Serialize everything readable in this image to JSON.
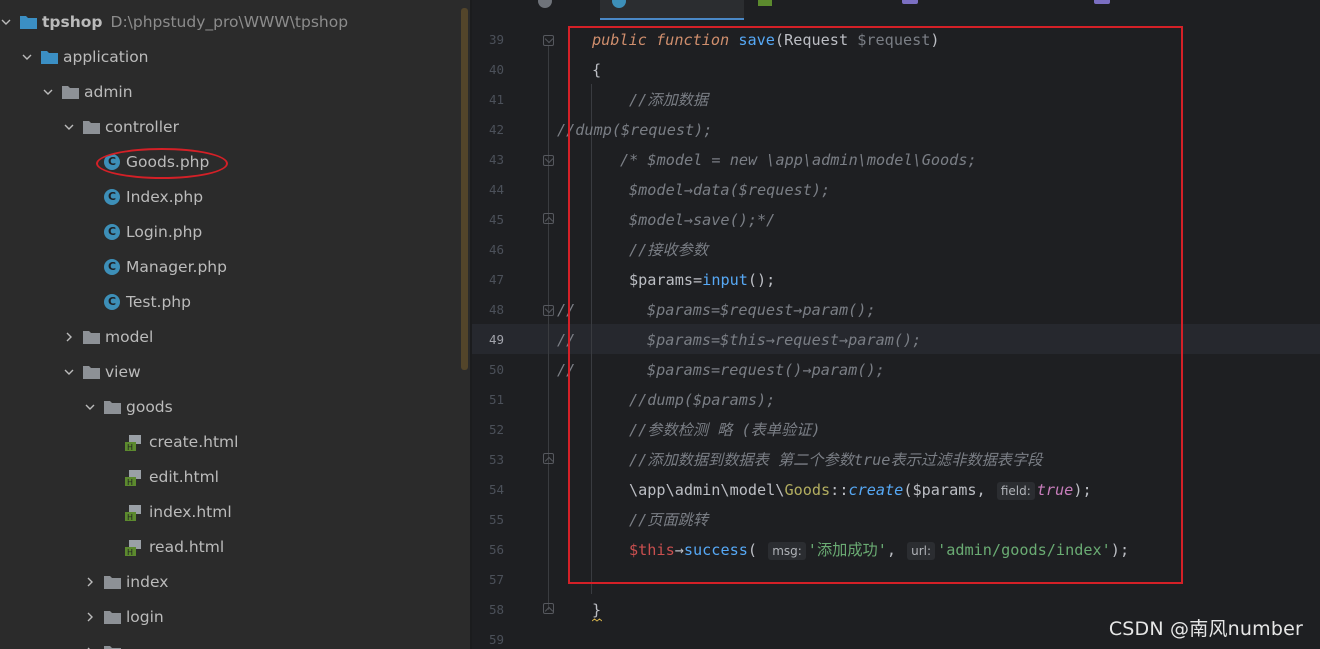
{
  "project_tree": {
    "root": {
      "name": "tpshop",
      "path": "D:\\phpstudy_pro\\WWW\\tpshop"
    },
    "items": [
      {
        "label": "application",
        "kind": "folder",
        "expanded": true
      },
      {
        "label": "admin",
        "kind": "folder",
        "expanded": true
      },
      {
        "label": "controller",
        "kind": "folder",
        "expanded": true
      },
      {
        "label": "Goods.php",
        "kind": "php-class"
      },
      {
        "label": "Index.php",
        "kind": "php-class"
      },
      {
        "label": "Login.php",
        "kind": "php-class"
      },
      {
        "label": "Manager.php",
        "kind": "php-class"
      },
      {
        "label": "Test.php",
        "kind": "php-class"
      },
      {
        "label": "model",
        "kind": "folder",
        "expanded": false
      },
      {
        "label": "view",
        "kind": "folder",
        "expanded": true
      },
      {
        "label": "goods",
        "kind": "folder",
        "expanded": true
      },
      {
        "label": "create.html",
        "kind": "html"
      },
      {
        "label": "edit.html",
        "kind": "html"
      },
      {
        "label": "index.html",
        "kind": "html"
      },
      {
        "label": "read.html",
        "kind": "html"
      },
      {
        "label": "index",
        "kind": "folder",
        "expanded": false
      },
      {
        "label": "login",
        "kind": "folder",
        "expanded": false
      }
    ]
  },
  "editor": {
    "current_line": "49",
    "line_numbers": [
      "39",
      "40",
      "41",
      "42",
      "43",
      "44",
      "45",
      "46",
      "47",
      "48",
      "49",
      "50",
      "51",
      "52",
      "53",
      "54",
      "55",
      "56",
      "57",
      "58",
      "59"
    ],
    "code": {
      "l39_public": "public",
      "l39_function": "function",
      "l39_name": "save",
      "l39_type": "Request",
      "l39_param": "$request",
      "l40": "{",
      "l41": "//添加数据",
      "l42": "//dump($request);",
      "l43": "/* $model = new \\app\\admin\\model\\Goods;",
      "l44": "$model→data($request);",
      "l45": "$model→save();*/",
      "l46": "//接收参数",
      "l47_var": "$params",
      "l47_fn": "input",
      "l48_mark": "//",
      "l48": "$params=$request→param();",
      "l49_mark": "//",
      "l49": "$params=$this→request→param();",
      "l50_mark": "//",
      "l50": "$params=request()→param();",
      "l51": "//dump($params);",
      "l52": "//参数检测 略 (表单验证)",
      "l53": "//添加数据到数据表 第二个参数true表示过滤非数据表字段",
      "l54_ns": "\\app\\admin\\model\\",
      "l54_cls": "Goods",
      "l54_fn": "create",
      "l54_var": "$params",
      "l54_hint": "field:",
      "l54_val": "true",
      "l55": "//页面跳转",
      "l56_this": "$this",
      "l56_fn": "success",
      "l56_hint1": "msg:",
      "l56_str1": "'添加成功'",
      "l56_hint2": "url:",
      "l56_str2": "'admin/goods/index'",
      "l58": "}"
    }
  },
  "watermark": "CSDN @南风number",
  "colors": {
    "annotation": "#d42027",
    "keyword": "#cf8e6d",
    "function": "#56a8f5",
    "string": "#6aab73",
    "comment": "#7a7e85"
  }
}
